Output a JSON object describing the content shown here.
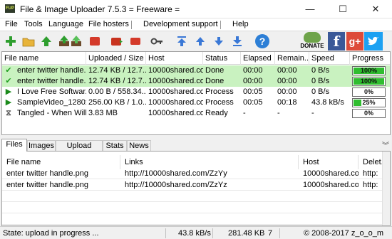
{
  "window": {
    "app_icon_text": "FUP",
    "title": "File & Image Uploader 7.5.3  = Freeware =",
    "minimize_glyph": "—",
    "maximize_glyph": "☐",
    "close_glyph": "✕"
  },
  "menu": [
    "File",
    "Tools",
    "Language",
    "File hosters",
    "Development support",
    "Help"
  ],
  "toolbar": {
    "donate_label": "DONATE",
    "facebook_glyph": "f",
    "googleplus_glyph": "g+",
    "help_glyph": "?"
  },
  "upload_grid": {
    "columns": [
      "File name",
      "Uploaded / Size",
      "Host",
      "Status",
      "Elapsed",
      "Remain...",
      "Speed",
      "Progress"
    ],
    "rows": [
      {
        "icon": "check-icon",
        "file_name": "enter twitter handle...",
        "uploaded_size": "12.74 KB / 12.7...",
        "host": "10000shared.com",
        "status": "Done",
        "elapsed": "00:00",
        "remain": "00:00",
        "speed": "0 B/s",
        "progress_text": "100%",
        "progress": 1.0,
        "done": true
      },
      {
        "icon": "check-icon",
        "file_name": "enter twitter handle...",
        "uploaded_size": "12.74 KB / 12.7...",
        "host": "10000shared.com",
        "status": "Done",
        "elapsed": "00:00",
        "remain": "00:00",
        "speed": "0 B/s",
        "progress_text": "100%",
        "progress": 1.0,
        "done": true
      },
      {
        "icon": "play-icon",
        "file_name": "I Love Free Softwar...",
        "uploaded_size": "0.00 B / 558.34...",
        "host": "10000shared.com",
        "status": "Process",
        "elapsed": "00:05",
        "remain": "00:00",
        "speed": "0 B/s",
        "progress_text": "0%",
        "progress": 0.0,
        "done": false
      },
      {
        "icon": "play-icon",
        "file_name": "SampleVideo_1280x...",
        "uploaded_size": "256.00 KB / 1.0...",
        "host": "10000shared.com",
        "status": "Process",
        "elapsed": "00:05",
        "remain": "00:18",
        "speed": "43.8 kB/s",
        "progress_text": "25%",
        "progress": 0.25,
        "done": false
      },
      {
        "icon": "wait-icon",
        "file_name": "Tangled - When Will...",
        "uploaded_size": "3.83 MB",
        "host": "10000shared.com",
        "status": "Ready",
        "elapsed": "-",
        "remain": "-",
        "speed": "-",
        "progress_text": "0%",
        "progress": 0.0,
        "done": false
      }
    ]
  },
  "tabs": [
    "Files",
    "Images",
    "Upload history",
    "Stats",
    "News"
  ],
  "files_panel": {
    "columns": [
      "File name",
      "Links",
      "Host",
      "Delet..."
    ],
    "rows": [
      {
        "file_name": "enter twitter handle.png",
        "link": "http://10000shared.com/ZzYy",
        "host": "10000shared.com",
        "delete": "http:"
      },
      {
        "file_name": "enter twitter handle.png",
        "link": "http://10000shared.com/ZzYz",
        "host": "10000shared.com",
        "delete": "http:"
      }
    ]
  },
  "status_bar": {
    "state": "State: upload in progress ...",
    "speed": "43.8 kB/s",
    "uploaded": "281.48 KB",
    "count": "7",
    "copyright": "© 2008-2017 z_o_o_m"
  },
  "colors": {
    "done_row": "#c9f2c0",
    "progress_fill": "#2fbd2f",
    "check_green": "#1e9e1e",
    "play_green": "#1a8a1a",
    "facebook": "#3b5998",
    "googleplus": "#dd4b39"
  }
}
